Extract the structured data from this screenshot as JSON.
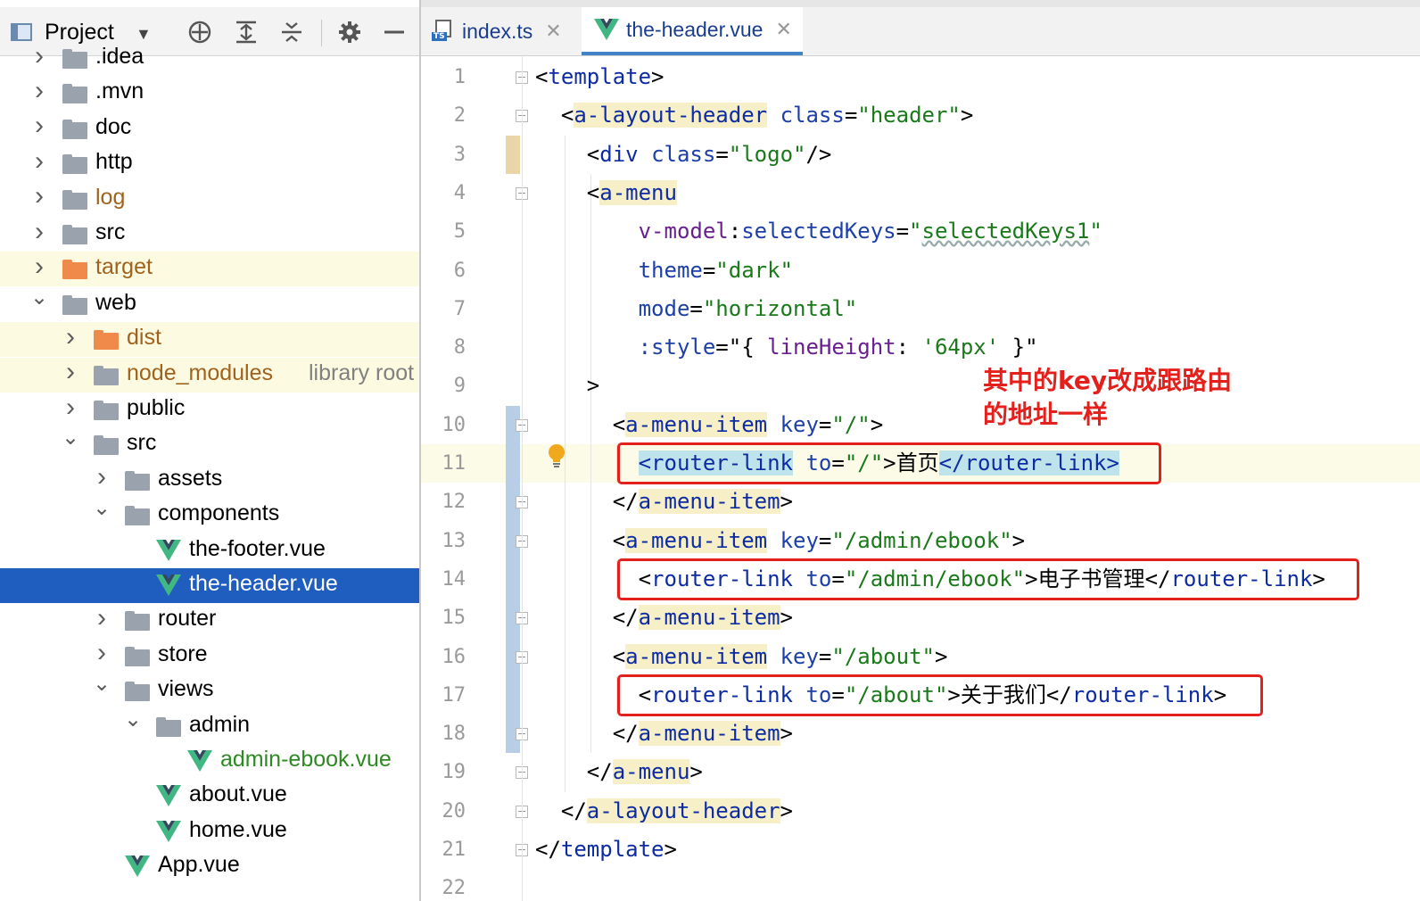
{
  "project_panel": {
    "title": "Project",
    "toolbar_icons": [
      "crosshair-icon",
      "expand-all-icon",
      "collapse-all-icon",
      "gear-icon",
      "minimize-icon"
    ]
  },
  "tree": [
    {
      "name": ".idea",
      "type": "folder",
      "color": "grey",
      "depth": 1,
      "arrow": "right",
      "state": "partial"
    },
    {
      "name": ".mvn",
      "type": "folder",
      "color": "grey",
      "depth": 1,
      "arrow": "right"
    },
    {
      "name": "doc",
      "type": "folder",
      "color": "grey",
      "depth": 1,
      "arrow": "right"
    },
    {
      "name": "http",
      "type": "folder",
      "color": "grey",
      "depth": 1,
      "arrow": "right"
    },
    {
      "name": "log",
      "type": "folder",
      "color": "grey",
      "depth": 1,
      "arrow": "right",
      "label_color": "orange"
    },
    {
      "name": "src",
      "type": "folder",
      "color": "grey",
      "depth": 1,
      "arrow": "right"
    },
    {
      "name": "target",
      "type": "folder",
      "color": "orange",
      "depth": 1,
      "arrow": "right",
      "label_color": "orange",
      "highlight": true
    },
    {
      "name": "web",
      "type": "folder",
      "color": "grey",
      "depth": 1,
      "arrow": "down"
    },
    {
      "name": "dist",
      "type": "folder",
      "color": "orange",
      "depth": 2,
      "arrow": "right",
      "label_color": "orange",
      "highlight": true
    },
    {
      "name": "node_modules",
      "extra": "library root",
      "type": "folder",
      "color": "grey",
      "depth": 2,
      "arrow": "right",
      "label_color": "orange",
      "highlight": true
    },
    {
      "name": "public",
      "type": "folder",
      "color": "grey",
      "depth": 2,
      "arrow": "right"
    },
    {
      "name": "src",
      "type": "folder",
      "color": "grey",
      "depth": 2,
      "arrow": "down"
    },
    {
      "name": "assets",
      "type": "folder",
      "color": "grey",
      "depth": 3,
      "arrow": "right"
    },
    {
      "name": "components",
      "type": "folder",
      "color": "grey",
      "depth": 3,
      "arrow": "down"
    },
    {
      "name": "the-footer.vue",
      "type": "vue",
      "depth": 4
    },
    {
      "name": "the-header.vue",
      "type": "vue",
      "depth": 4,
      "selected": true
    },
    {
      "name": "router",
      "type": "folder",
      "color": "grey",
      "depth": 3,
      "arrow": "right"
    },
    {
      "name": "store",
      "type": "folder",
      "color": "grey",
      "depth": 3,
      "arrow": "right"
    },
    {
      "name": "views",
      "type": "folder",
      "color": "grey",
      "depth": 3,
      "arrow": "down"
    },
    {
      "name": "admin",
      "type": "folder",
      "color": "grey",
      "depth": 4,
      "arrow": "down"
    },
    {
      "name": "admin-ebook.vue",
      "type": "vue",
      "depth": 5,
      "label_color": "green"
    },
    {
      "name": "about.vue",
      "type": "vue",
      "depth": 4
    },
    {
      "name": "home.vue",
      "type": "vue",
      "depth": 4
    },
    {
      "name": "App.vue",
      "type": "vue",
      "depth": 3
    }
  ],
  "tabs": [
    {
      "label": "index.ts",
      "icon": "typescript-file-icon",
      "badge": "TS",
      "active": false
    },
    {
      "label": "the-header.vue",
      "icon": "vue-file-icon",
      "active": true
    }
  ],
  "code": {
    "current_line": 11,
    "lines": [
      {
        "n": "1",
        "tokens": [
          [
            "p",
            "<"
          ],
          [
            "tag",
            "template"
          ],
          [
            "p",
            ">"
          ]
        ]
      },
      {
        "n": "2",
        "tokens": [
          [
            "p",
            "  <"
          ],
          [
            "comp",
            "a-layout-header"
          ],
          [
            "p",
            " "
          ],
          [
            "attr",
            "class"
          ],
          [
            "p",
            "="
          ],
          [
            "str",
            "\"header\""
          ],
          [
            "p",
            ">"
          ]
        ]
      },
      {
        "n": "3",
        "tokens": [
          [
            "p",
            "    <"
          ],
          [
            "tag",
            "div"
          ],
          [
            "p",
            " "
          ],
          [
            "attr",
            "class"
          ],
          [
            "p",
            "="
          ],
          [
            "str",
            "\"logo\""
          ],
          [
            "p",
            "/>"
          ]
        ]
      },
      {
        "n": "4",
        "tokens": [
          [
            "p",
            "    <"
          ],
          [
            "comp",
            "a-menu"
          ]
        ]
      },
      {
        "n": "5",
        "tokens": [
          [
            "p",
            "        "
          ],
          [
            "dir",
            "v-model"
          ],
          [
            "p",
            ":"
          ],
          [
            "attr",
            "selectedKeys"
          ],
          [
            "p",
            "="
          ],
          [
            "str",
            "\""
          ],
          [
            "squig",
            "selectedKeys1"
          ],
          [
            "str",
            "\""
          ]
        ]
      },
      {
        "n": "6",
        "tokens": [
          [
            "p",
            "        "
          ],
          [
            "attr",
            "theme"
          ],
          [
            "p",
            "="
          ],
          [
            "str",
            "\"dark\""
          ]
        ]
      },
      {
        "n": "7",
        "tokens": [
          [
            "p",
            "        "
          ],
          [
            "attr",
            "mode"
          ],
          [
            "p",
            "="
          ],
          [
            "str",
            "\"horizontal\""
          ]
        ]
      },
      {
        "n": "8",
        "tokens": [
          [
            "p",
            "        "
          ],
          [
            "attr",
            ":style"
          ],
          [
            "p",
            "=\"{ "
          ],
          [
            "dir",
            "lineHeight"
          ],
          [
            "p",
            ": "
          ],
          [
            "str",
            "'64px'"
          ],
          [
            "p",
            " }\""
          ]
        ]
      },
      {
        "n": "9",
        "tokens": [
          [
            "p",
            "    >"
          ]
        ]
      },
      {
        "n": "10",
        "tokens": [
          [
            "p",
            "      <"
          ],
          [
            "comp",
            "a-menu-item"
          ],
          [
            "p",
            " "
          ],
          [
            "attr",
            "key"
          ],
          [
            "p",
            "="
          ],
          [
            "str",
            "\"/\""
          ],
          [
            "p",
            ">"
          ]
        ]
      },
      {
        "n": "11",
        "tokens": [
          [
            "p",
            "        "
          ],
          [
            "link",
            "<"
          ],
          [
            "linkt",
            "router-link"
          ],
          [
            "p",
            " "
          ],
          [
            "attr",
            "to"
          ],
          [
            "p",
            "="
          ],
          [
            "str",
            "\"/\""
          ],
          [
            "p",
            ">"
          ],
          [
            "cn",
            "首页"
          ],
          [
            "linkt",
            "</router-link"
          ],
          [
            "link",
            ">"
          ]
        ]
      },
      {
        "n": "12",
        "tokens": [
          [
            "p",
            "      </"
          ],
          [
            "comp",
            "a-menu-item"
          ],
          [
            "p",
            ">"
          ]
        ]
      },
      {
        "n": "13",
        "tokens": [
          [
            "p",
            "      <"
          ],
          [
            "comp",
            "a-menu-item"
          ],
          [
            "p",
            " "
          ],
          [
            "attr",
            "key"
          ],
          [
            "p",
            "="
          ],
          [
            "str",
            "\"/admin/ebook\""
          ],
          [
            "p",
            ">"
          ]
        ]
      },
      {
        "n": "14",
        "tokens": [
          [
            "p",
            "        <"
          ],
          [
            "tag",
            "router-link"
          ],
          [
            "p",
            " "
          ],
          [
            "attr",
            "to"
          ],
          [
            "p",
            "="
          ],
          [
            "str",
            "\"/admin/ebook\""
          ],
          [
            "p",
            ">"
          ],
          [
            "cn",
            "电子书管理"
          ],
          [
            "p",
            "</"
          ],
          [
            "tag",
            "router-link"
          ],
          [
            "p",
            ">"
          ]
        ]
      },
      {
        "n": "15",
        "tokens": [
          [
            "p",
            "      </"
          ],
          [
            "comp",
            "a-menu-item"
          ],
          [
            "p",
            ">"
          ]
        ]
      },
      {
        "n": "16",
        "tokens": [
          [
            "p",
            "      <"
          ],
          [
            "comp",
            "a-menu-item"
          ],
          [
            "p",
            " "
          ],
          [
            "attr",
            "key"
          ],
          [
            "p",
            "="
          ],
          [
            "str",
            "\"/about\""
          ],
          [
            "p",
            ">"
          ]
        ]
      },
      {
        "n": "17",
        "tokens": [
          [
            "p",
            "        <"
          ],
          [
            "tag",
            "router-link"
          ],
          [
            "p",
            " "
          ],
          [
            "attr",
            "to"
          ],
          [
            "p",
            "="
          ],
          [
            "str",
            "\"/about\""
          ],
          [
            "p",
            ">"
          ],
          [
            "cn",
            "关于我们"
          ],
          [
            "p",
            "</"
          ],
          [
            "tag",
            "router-link"
          ],
          [
            "p",
            ">"
          ]
        ]
      },
      {
        "n": "18",
        "tokens": [
          [
            "p",
            "      </"
          ],
          [
            "comp",
            "a-menu-item"
          ],
          [
            "p",
            ">"
          ]
        ]
      },
      {
        "n": "19",
        "tokens": [
          [
            "p",
            "    </"
          ],
          [
            "comp",
            "a-menu"
          ],
          [
            "p",
            ">"
          ]
        ]
      },
      {
        "n": "20",
        "tokens": [
          [
            "p",
            "  </"
          ],
          [
            "comp",
            "a-layout-header"
          ],
          [
            "p",
            ">"
          ]
        ]
      },
      {
        "n": "21",
        "tokens": [
          [
            "p",
            "</"
          ],
          [
            "tag",
            "template"
          ],
          [
            "p",
            ">"
          ]
        ]
      },
      {
        "n": "22",
        "tokens": []
      }
    ]
  },
  "annotation": {
    "line1": "其中的key改成跟路由",
    "line2": "的地址一样"
  },
  "colors": {
    "selection": "#1f5ebf",
    "highlight_row": "#fcfae1",
    "red_box": "#e3201b",
    "tag": "#0d2ba3",
    "string": "#1a7a1a"
  }
}
